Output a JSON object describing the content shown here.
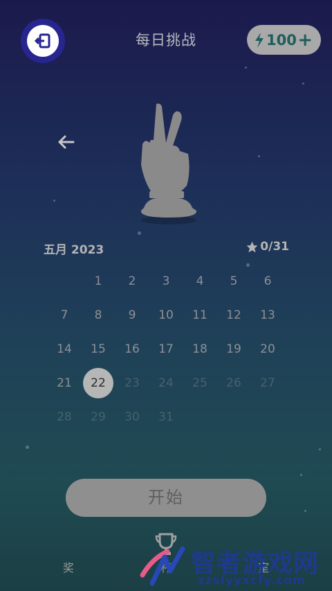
{
  "header": {
    "title": "每日挑战",
    "energy_value": "100",
    "energy_plus": "+"
  },
  "calendar": {
    "month_label": "五月 2023",
    "stars_count": "0/31",
    "today": "22",
    "days": [
      "1",
      "2",
      "3",
      "4",
      "5",
      "6",
      "7",
      "8",
      "9",
      "10",
      "11",
      "12",
      "13",
      "14",
      "15",
      "16",
      "17",
      "18",
      "19",
      "20",
      "21",
      "22",
      "23",
      "24",
      "25",
      "26",
      "27",
      "28",
      "29",
      "30",
      "31"
    ]
  },
  "actions": {
    "start_label": "开始",
    "bottom_label": "奖 杯 室"
  },
  "watermark": {
    "text": "智者游戏网",
    "url": "zzslyyxcfy.com"
  },
  "colors": {
    "accent_blue": "#27258f",
    "energy_text": "#1f5e5a",
    "today_bg": "#b6b6b6"
  },
  "icons": [
    "exit-icon",
    "lightning-icon",
    "plus-icon",
    "back-arrow-icon",
    "victory-hand-trophy",
    "star-icon",
    "trophy-cup-icon"
  ]
}
